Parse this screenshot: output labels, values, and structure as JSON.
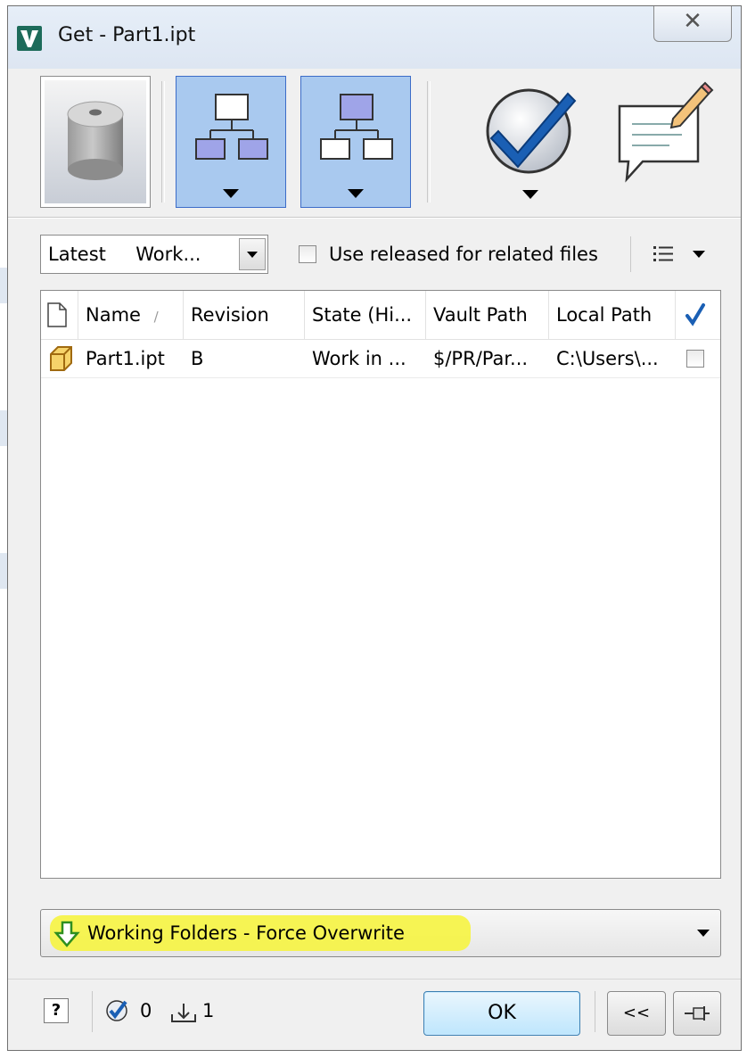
{
  "window": {
    "title": "Get - Part1.ipt",
    "close_glyph": "✕"
  },
  "toolbar": {
    "thumbnail": "part-thumbnail",
    "buttons": [
      {
        "icon": "include-children-icon",
        "selected": true
      },
      {
        "icon": "include-parents-icon",
        "selected": true
      },
      {
        "icon": "check-icon",
        "selected": false
      },
      {
        "icon": "comment-icon",
        "selected": false
      }
    ]
  },
  "options": {
    "version": "Latest     Work...",
    "released_checkbox_label": "Use released for related files",
    "released_checked": false,
    "view_options_icon": "list-options-icon"
  },
  "grid": {
    "columns": [
      {
        "label": "",
        "icon": "file-icon"
      },
      {
        "label": "Name",
        "sort": "/"
      },
      {
        "label": "Revision"
      },
      {
        "label": "State (Hi..."
      },
      {
        "label": "Vault Path"
      },
      {
        "label": "Local Path"
      },
      {
        "label": "",
        "icon": "checkmark-icon"
      }
    ],
    "rows": [
      {
        "icon": "part-icon",
        "name": "Part1.ipt",
        "revision": "B",
        "state": "Work in ...",
        "vault_path": "$/PR/Par...",
        "local_path": "C:\\Users\\...",
        "checked": false
      }
    ]
  },
  "action": {
    "label": "Working Folders - Force Overwrite",
    "icon": "download-arrow-icon",
    "highlight_color": "#f6f34a"
  },
  "footer": {
    "help_label": "?",
    "checked_count": "0",
    "download_count": "1",
    "ok_label": "OK",
    "collapse_label": "<<",
    "pin_icon": "pin-icon"
  },
  "colors": {
    "selected_button": "#a9c9ef",
    "accent_blue": "#1a5fb4"
  }
}
